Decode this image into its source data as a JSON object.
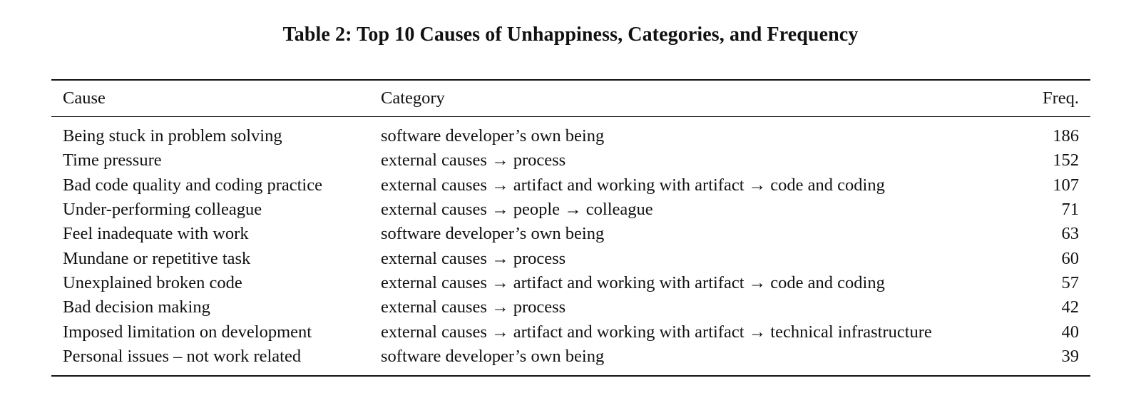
{
  "caption": "Table 2: Top 10 Causes of Unhappiness, Categories, and Frequency",
  "table": {
    "headers": {
      "cause": "Cause",
      "category": "Category",
      "freq": "Freq."
    },
    "rows": [
      {
        "cause": "Being stuck in problem solving",
        "category": "software developer’s own being",
        "freq": "186"
      },
      {
        "cause": "Time pressure",
        "category": "external causes → process",
        "freq": "152"
      },
      {
        "cause": "Bad code quality and coding practice",
        "category": "external causes → artifact and working with artifact → code and coding",
        "freq": "107"
      },
      {
        "cause": "Under-performing colleague",
        "category": "external causes → people → colleague",
        "freq": "71"
      },
      {
        "cause": "Feel inadequate with work",
        "category": "software developer’s own being",
        "freq": "63"
      },
      {
        "cause": "Mundane or repetitive task",
        "category": "external causes → process",
        "freq": "60"
      },
      {
        "cause": "Unexplained broken code",
        "category": "external causes → artifact and working with artifact → code and coding",
        "freq": "57"
      },
      {
        "cause": "Bad decision making",
        "category": "external causes → process",
        "freq": "42"
      },
      {
        "cause": "Imposed limitation on development",
        "category": "external causes → artifact and working with artifact → technical infrastructure",
        "freq": "40"
      },
      {
        "cause": "Personal issues – not work related",
        "category": "software developer’s own being",
        "freq": "39"
      }
    ]
  }
}
